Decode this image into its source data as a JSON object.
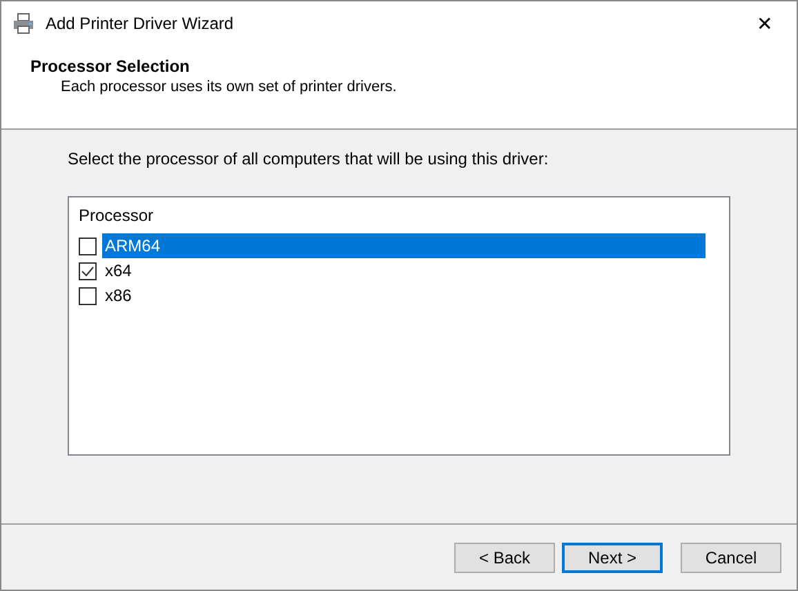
{
  "window": {
    "title": "Add Printer Driver Wizard",
    "close": "✕"
  },
  "header": {
    "title": "Processor Selection",
    "subtitle": "Each processor uses its own set of printer drivers."
  },
  "instruction": "Select the processor of all computers that will be using this driver:",
  "list": {
    "column": "Processor",
    "items": [
      {
        "label": "ARM64",
        "checked": false,
        "selected": true
      },
      {
        "label": "x64",
        "checked": true,
        "selected": false
      },
      {
        "label": "x86",
        "checked": false,
        "selected": false
      }
    ]
  },
  "buttons": [
    {
      "label": "< Back",
      "default": false
    },
    {
      "label": "Next >",
      "default": true
    },
    {
      "label": "Cancel",
      "default": false
    }
  ]
}
